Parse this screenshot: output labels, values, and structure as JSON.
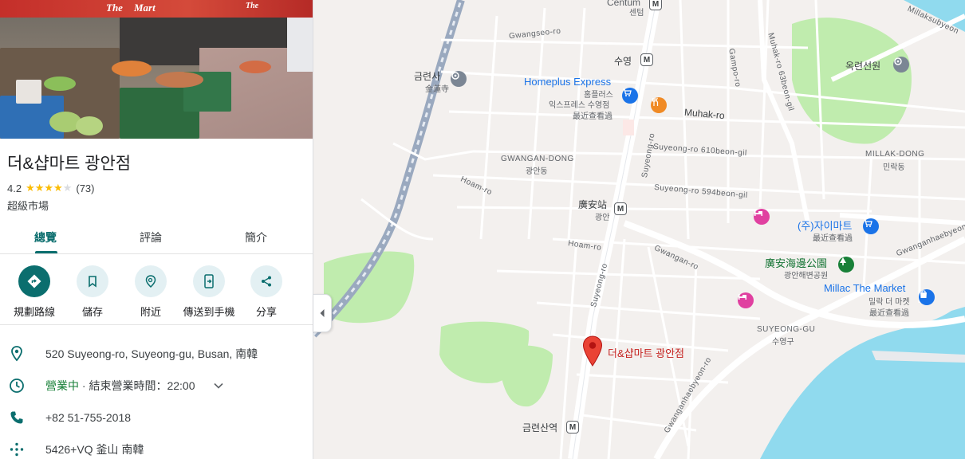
{
  "hero": {
    "sign_left": "The",
    "sign_mart": "Mart",
    "sign_right": "The"
  },
  "place": {
    "name": "더&샵마트 광안점",
    "rating": "4.2",
    "rating_value": 4.2,
    "stars": "★★★★★",
    "review_count": "(73)",
    "category": "超級市場"
  },
  "tabs": [
    {
      "label": "總覽"
    },
    {
      "label": "評論"
    },
    {
      "label": "簡介"
    }
  ],
  "actions": [
    {
      "label": "規劃路線",
      "icon": "directions-icon"
    },
    {
      "label": "儲存",
      "icon": "bookmark-icon"
    },
    {
      "label": "附近",
      "icon": "nearby-icon"
    },
    {
      "label": "傳送到手機",
      "icon": "send-to-phone-icon"
    },
    {
      "label": "分享",
      "icon": "share-icon"
    }
  ],
  "info": {
    "address": "520 Suyeong-ro, Suyeong-gu, Busan, 南韓",
    "open_status": "營業中",
    "hours": " · 結束營業時間：22:00",
    "phone": "+82 51-755-2018",
    "plus_code": "5426+VQ 釜山 南韓"
  },
  "map": {
    "labels": {
      "centum_en": "Centum",
      "centum_ko": "센텀",
      "gwangseo_ro": "Gwangseo-ro",
      "suyeong_ko": "수영",
      "gamporo": "Gampo-ro",
      "muhak_63": "Muhak-ro 63beon-gil",
      "millakbyeon": "Millaksubyeon",
      "okryeon_ko": "옥련선원",
      "geumryeon_ko": "금련사",
      "geumryeon_sub": "金蓮寺",
      "homeplus_en": "Homeplus Express",
      "homeplus_ko": "홈플러스",
      "homeplus_ko2": "익스프레스 수영점",
      "recent": "最近查看過",
      "muhak_ro": "Muhak-ro",
      "gwangan_dong": "GWANGAN-DONG",
      "gwangan_dong_ko": "광안동",
      "suyeong_ro_610": "Suyeong-ro 610beon-gil",
      "millak_dong": "MILLAK-DONG",
      "millak_dong_ko": "민락동",
      "suyeong_ro_vert": "Suyeong-ro",
      "hoam_ro": "Hoam-ro",
      "suyeong_ro_594": "Suyeong-ro 594beon-gil",
      "gwangan_station": "廣安站",
      "gwangan_station_ko": "광안",
      "jai_mart": "(주)자이마트",
      "gwanganhaebyeon": "Gwanganhaebyeon",
      "hoam_ro2": "Hoam-ro",
      "gwangan_ro": "Gwangan-ro",
      "park_zh": "廣安海邊公園",
      "park_ko": "광안해변공원",
      "millac_en": "Millac The Market",
      "millac_ko": "밀락 더 마켓",
      "suyeong_gu": "SUYEONG-GU",
      "suyeong_gu_ko": "수영구",
      "suyeong_ro_lower": "Suyeong-ro",
      "selected_place": "더&샵마트 광안점",
      "gwanganhaebyeon_ro": "Gwanganhaebyeon-ro",
      "geumryeonsan": "금련산역"
    },
    "metro_symbol": "M",
    "colors": {
      "land": "#f3f0ee",
      "water": "#90daee",
      "park": "#c0ecae",
      "road": "#ffffff",
      "railway": "#9aa9bf",
      "pin": "#ea4335",
      "teal": "#0b6e6e"
    }
  }
}
